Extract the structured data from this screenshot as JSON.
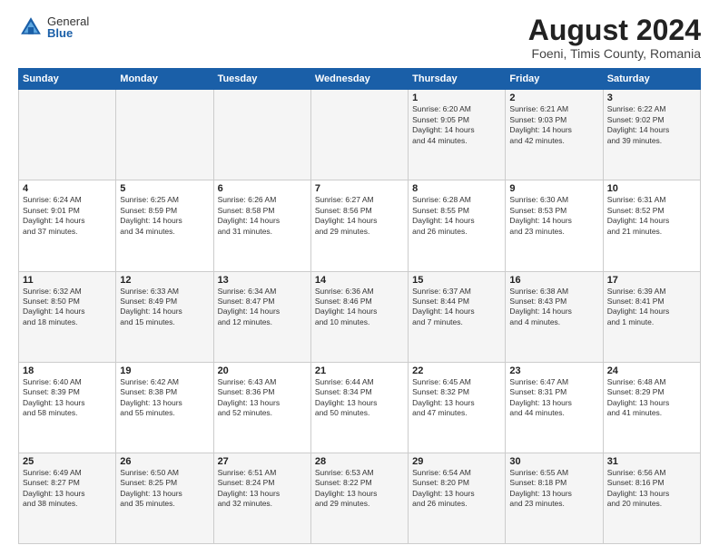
{
  "header": {
    "logo_general": "General",
    "logo_blue": "Blue",
    "month_title": "August 2024",
    "location": "Foeni, Timis County, Romania"
  },
  "calendar": {
    "days_of_week": [
      "Sunday",
      "Monday",
      "Tuesday",
      "Wednesday",
      "Thursday",
      "Friday",
      "Saturday"
    ],
    "weeks": [
      [
        {
          "day": "",
          "info": ""
        },
        {
          "day": "",
          "info": ""
        },
        {
          "day": "",
          "info": ""
        },
        {
          "day": "",
          "info": ""
        },
        {
          "day": "1",
          "info": "Sunrise: 6:20 AM\nSunset: 9:05 PM\nDaylight: 14 hours\nand 44 minutes."
        },
        {
          "day": "2",
          "info": "Sunrise: 6:21 AM\nSunset: 9:03 PM\nDaylight: 14 hours\nand 42 minutes."
        },
        {
          "day": "3",
          "info": "Sunrise: 6:22 AM\nSunset: 9:02 PM\nDaylight: 14 hours\nand 39 minutes."
        }
      ],
      [
        {
          "day": "4",
          "info": "Sunrise: 6:24 AM\nSunset: 9:01 PM\nDaylight: 14 hours\nand 37 minutes."
        },
        {
          "day": "5",
          "info": "Sunrise: 6:25 AM\nSunset: 8:59 PM\nDaylight: 14 hours\nand 34 minutes."
        },
        {
          "day": "6",
          "info": "Sunrise: 6:26 AM\nSunset: 8:58 PM\nDaylight: 14 hours\nand 31 minutes."
        },
        {
          "day": "7",
          "info": "Sunrise: 6:27 AM\nSunset: 8:56 PM\nDaylight: 14 hours\nand 29 minutes."
        },
        {
          "day": "8",
          "info": "Sunrise: 6:28 AM\nSunset: 8:55 PM\nDaylight: 14 hours\nand 26 minutes."
        },
        {
          "day": "9",
          "info": "Sunrise: 6:30 AM\nSunset: 8:53 PM\nDaylight: 14 hours\nand 23 minutes."
        },
        {
          "day": "10",
          "info": "Sunrise: 6:31 AM\nSunset: 8:52 PM\nDaylight: 14 hours\nand 21 minutes."
        }
      ],
      [
        {
          "day": "11",
          "info": "Sunrise: 6:32 AM\nSunset: 8:50 PM\nDaylight: 14 hours\nand 18 minutes."
        },
        {
          "day": "12",
          "info": "Sunrise: 6:33 AM\nSunset: 8:49 PM\nDaylight: 14 hours\nand 15 minutes."
        },
        {
          "day": "13",
          "info": "Sunrise: 6:34 AM\nSunset: 8:47 PM\nDaylight: 14 hours\nand 12 minutes."
        },
        {
          "day": "14",
          "info": "Sunrise: 6:36 AM\nSunset: 8:46 PM\nDaylight: 14 hours\nand 10 minutes."
        },
        {
          "day": "15",
          "info": "Sunrise: 6:37 AM\nSunset: 8:44 PM\nDaylight: 14 hours\nand 7 minutes."
        },
        {
          "day": "16",
          "info": "Sunrise: 6:38 AM\nSunset: 8:43 PM\nDaylight: 14 hours\nand 4 minutes."
        },
        {
          "day": "17",
          "info": "Sunrise: 6:39 AM\nSunset: 8:41 PM\nDaylight: 14 hours\nand 1 minute."
        }
      ],
      [
        {
          "day": "18",
          "info": "Sunrise: 6:40 AM\nSunset: 8:39 PM\nDaylight: 13 hours\nand 58 minutes."
        },
        {
          "day": "19",
          "info": "Sunrise: 6:42 AM\nSunset: 8:38 PM\nDaylight: 13 hours\nand 55 minutes."
        },
        {
          "day": "20",
          "info": "Sunrise: 6:43 AM\nSunset: 8:36 PM\nDaylight: 13 hours\nand 52 minutes."
        },
        {
          "day": "21",
          "info": "Sunrise: 6:44 AM\nSunset: 8:34 PM\nDaylight: 13 hours\nand 50 minutes."
        },
        {
          "day": "22",
          "info": "Sunrise: 6:45 AM\nSunset: 8:32 PM\nDaylight: 13 hours\nand 47 minutes."
        },
        {
          "day": "23",
          "info": "Sunrise: 6:47 AM\nSunset: 8:31 PM\nDaylight: 13 hours\nand 44 minutes."
        },
        {
          "day": "24",
          "info": "Sunrise: 6:48 AM\nSunset: 8:29 PM\nDaylight: 13 hours\nand 41 minutes."
        }
      ],
      [
        {
          "day": "25",
          "info": "Sunrise: 6:49 AM\nSunset: 8:27 PM\nDaylight: 13 hours\nand 38 minutes."
        },
        {
          "day": "26",
          "info": "Sunrise: 6:50 AM\nSunset: 8:25 PM\nDaylight: 13 hours\nand 35 minutes."
        },
        {
          "day": "27",
          "info": "Sunrise: 6:51 AM\nSunset: 8:24 PM\nDaylight: 13 hours\nand 32 minutes."
        },
        {
          "day": "28",
          "info": "Sunrise: 6:53 AM\nSunset: 8:22 PM\nDaylight: 13 hours\nand 29 minutes."
        },
        {
          "day": "29",
          "info": "Sunrise: 6:54 AM\nSunset: 8:20 PM\nDaylight: 13 hours\nand 26 minutes."
        },
        {
          "day": "30",
          "info": "Sunrise: 6:55 AM\nSunset: 8:18 PM\nDaylight: 13 hours\nand 23 minutes."
        },
        {
          "day": "31",
          "info": "Sunrise: 6:56 AM\nSunset: 8:16 PM\nDaylight: 13 hours\nand 20 minutes."
        }
      ]
    ]
  }
}
